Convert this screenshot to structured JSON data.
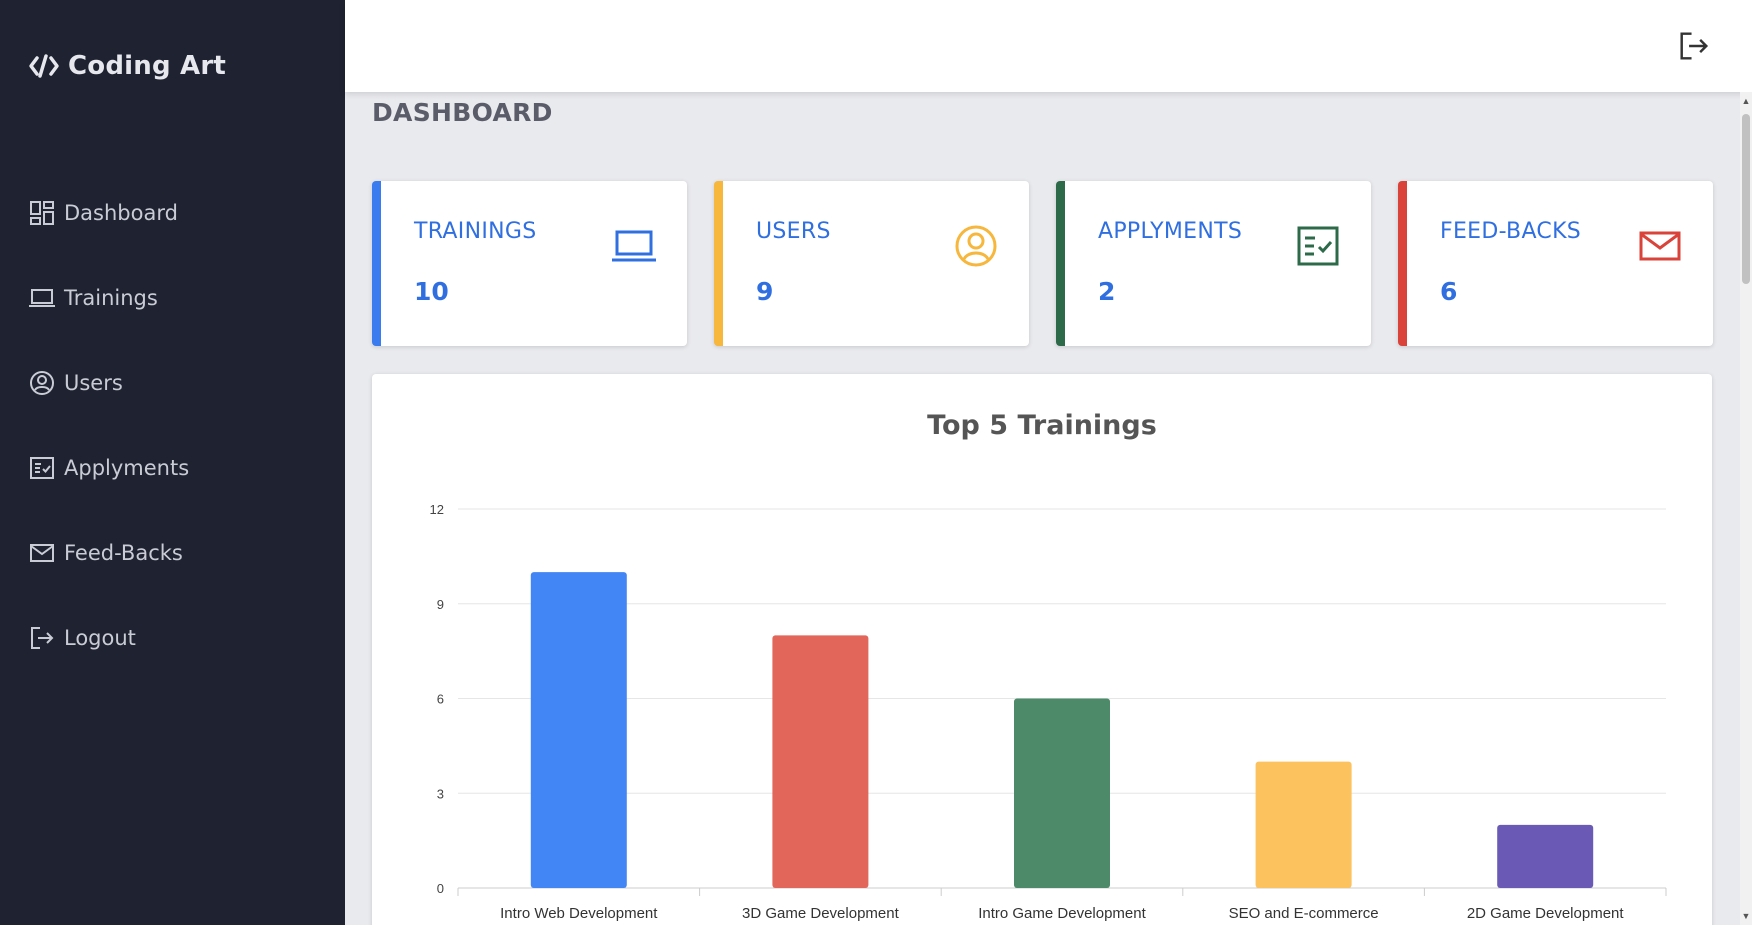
{
  "brand": {
    "name": "Coding Art",
    "icon": "code-slash-icon"
  },
  "sidebar": {
    "items": [
      {
        "label": "Dashboard",
        "icon": "dashboard-grid-icon"
      },
      {
        "label": "Trainings",
        "icon": "laptop-icon"
      },
      {
        "label": "Users",
        "icon": "user-circle-icon"
      },
      {
        "label": "Applyments",
        "icon": "checklist-icon"
      },
      {
        "label": "Feed-Backs",
        "icon": "envelope-icon"
      },
      {
        "label": "Logout",
        "icon": "logout-icon"
      }
    ]
  },
  "topbar": {
    "logout_icon": "logout-icon"
  },
  "page": {
    "title": "DASHBOARD"
  },
  "cards": [
    {
      "label": "TRAININGS",
      "value": "10",
      "icon": "laptop-icon",
      "color": "#3a7bf0"
    },
    {
      "label": "USERS",
      "value": "9",
      "icon": "user-circle-icon",
      "color": "#f6b73c"
    },
    {
      "label": "APPLYMENTS",
      "value": "2",
      "icon": "checklist-icon",
      "color": "#2d6a4a"
    },
    {
      "label": "FEED-BACKS",
      "value": "6",
      "icon": "envelope-icon",
      "color": "#d9433a"
    }
  ],
  "chart_data": {
    "type": "bar",
    "title": "Top 5 Trainings",
    "categories": [
      "Intro Web Development",
      "3D Game Development",
      "Intro Game Development",
      "SEO and E-commerce",
      "2D Game Development"
    ],
    "values": [
      10,
      8,
      6,
      4,
      2
    ],
    "colors": [
      "#4285f4",
      "#e2665a",
      "#4d8a6a",
      "#fbc25d",
      "#6a5ab5"
    ],
    "ylim": [
      0,
      12
    ],
    "yticks": [
      "0",
      "3",
      "6",
      "9",
      "12"
    ],
    "grid": true,
    "legend": "none"
  }
}
